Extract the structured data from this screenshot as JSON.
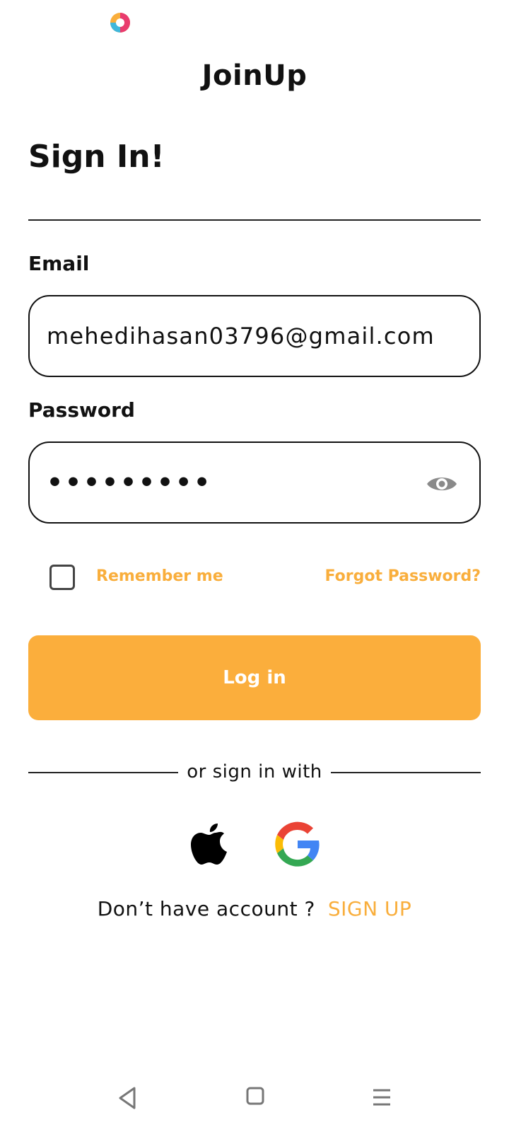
{
  "app": {
    "title": "JoinUp",
    "brand_color": "#F9AE3C"
  },
  "page": {
    "title": "Sign In!"
  },
  "form": {
    "email_label": "Email",
    "email_value": "mehedihasan03796@gmail.com",
    "password_label": "Password",
    "password_value": "•••••••••",
    "show_password_icon": "eye-icon",
    "remember_label": "Remember me",
    "remember_checked": false,
    "forgot_label": "Forgot Password?",
    "login_label": "Log in"
  },
  "social": {
    "divider_text": "or sign in with",
    "providers": [
      "apple-icon",
      "google-icon"
    ]
  },
  "signup": {
    "prompt": "Don’t have account ?",
    "link": "SIGN UP"
  },
  "nav": {
    "icons": [
      "back-icon",
      "home-icon",
      "menu-icon"
    ]
  }
}
